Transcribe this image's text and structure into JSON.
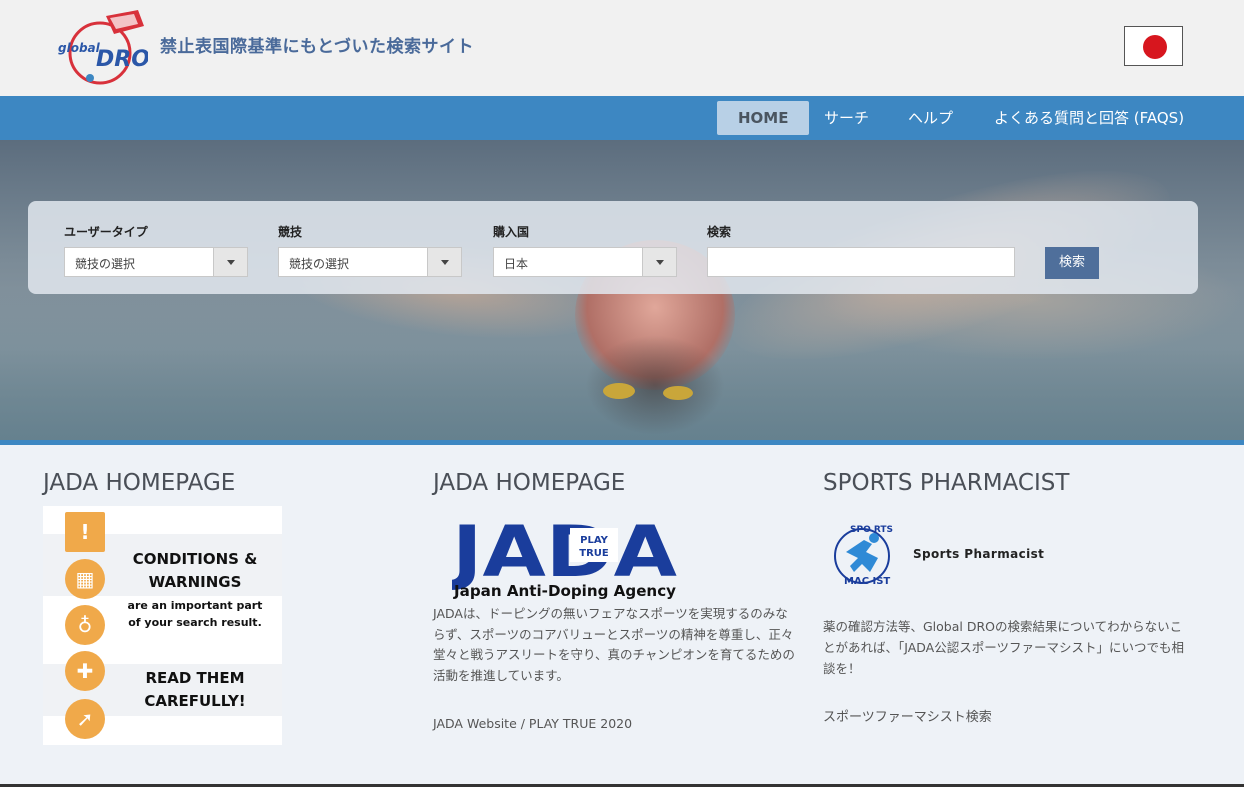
{
  "header": {
    "logo_text_top": "global",
    "logo_text_main": "DRO",
    "tagline": "禁止表国際基準にもとづいた検索サイト",
    "language_flag": "japan-flag-icon"
  },
  "nav": {
    "items": [
      {
        "label": "HOME",
        "active": true
      },
      {
        "label": "サーチ",
        "active": false
      },
      {
        "label": "ヘルプ",
        "active": false
      },
      {
        "label": "よくある質問と回答 (FAQS)",
        "active": false
      }
    ]
  },
  "search": {
    "fields": [
      {
        "label": "ユーザータイプ",
        "value": "競技の選択"
      },
      {
        "label": "競技",
        "value": "競技の選択"
      },
      {
        "label": "購入国",
        "value": "日本"
      },
      {
        "label": "検索",
        "value": ""
      }
    ],
    "button_label": "検索"
  },
  "columns": {
    "left": {
      "title": "JADA HOMEPAGE",
      "card": {
        "line1": "CONDITIONS &",
        "line2": "WARNINGS",
        "line3": "are an important part",
        "line4": "of your search result.",
        "line5": "READ THEM",
        "line6": "CAREFULLY!"
      }
    },
    "middle": {
      "title": "JADA HOMEPAGE",
      "logo_main": "JADA",
      "logo_badge_1": "PLAY",
      "logo_badge_2": "TRUE",
      "logo_caption": "Japan Anti-Doping Agency",
      "description": "JADAは、ドーピングの無いフェアなスポーツを実現するのみならず、スポーツのコアバリューとスポーツの精神を尊重し、正々堂々と戦うアスリートを守り、真のチャンピオンを育てるための活動を推進しています。",
      "link": "JADA Website / PLAY TRUE 2020"
    },
    "right": {
      "title": "SPORTS PHARMACIST",
      "logo_text_top": "SPO RTS",
      "logo_text_bottom": "MAC IST",
      "logo_name": "Sports Pharmacist",
      "description": "薬の確認方法等、Global DROの検索結果についてわからないことがあれば、「JADA公認スポーツファーマシスト」にいつでも相談を！",
      "link": "スポーツファーマシスト検索"
    }
  },
  "colors": {
    "nav_bar": "#3d87c2",
    "nav_active": "#b8d0e6",
    "search_button": "#4f6f9b",
    "warning_orange": "#f0a94a",
    "jada_blue": "#1a3d9c",
    "flag_red": "#d7161e"
  }
}
